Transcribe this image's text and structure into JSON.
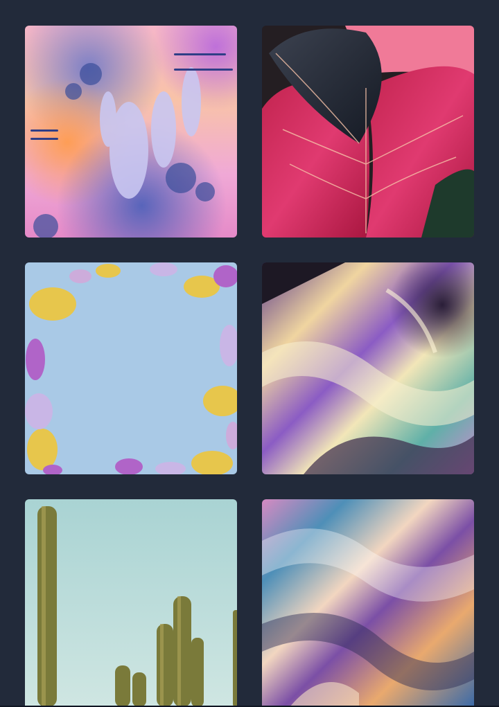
{
  "gallery": {
    "background": "#222a3a",
    "tiles": [
      {
        "id": "lupine",
        "name": "watercolor-lupine-flowers-image"
      },
      {
        "id": "leaves",
        "name": "pink-tropical-leaves-image"
      },
      {
        "id": "paper",
        "name": "paper-cut-leaves-frame-image"
      },
      {
        "id": "chrome1",
        "name": "iridescent-chrome-wave-image"
      },
      {
        "id": "cactus",
        "name": "cactus-sky-image"
      },
      {
        "id": "chrome2",
        "name": "holographic-fabric-image"
      }
    ]
  }
}
